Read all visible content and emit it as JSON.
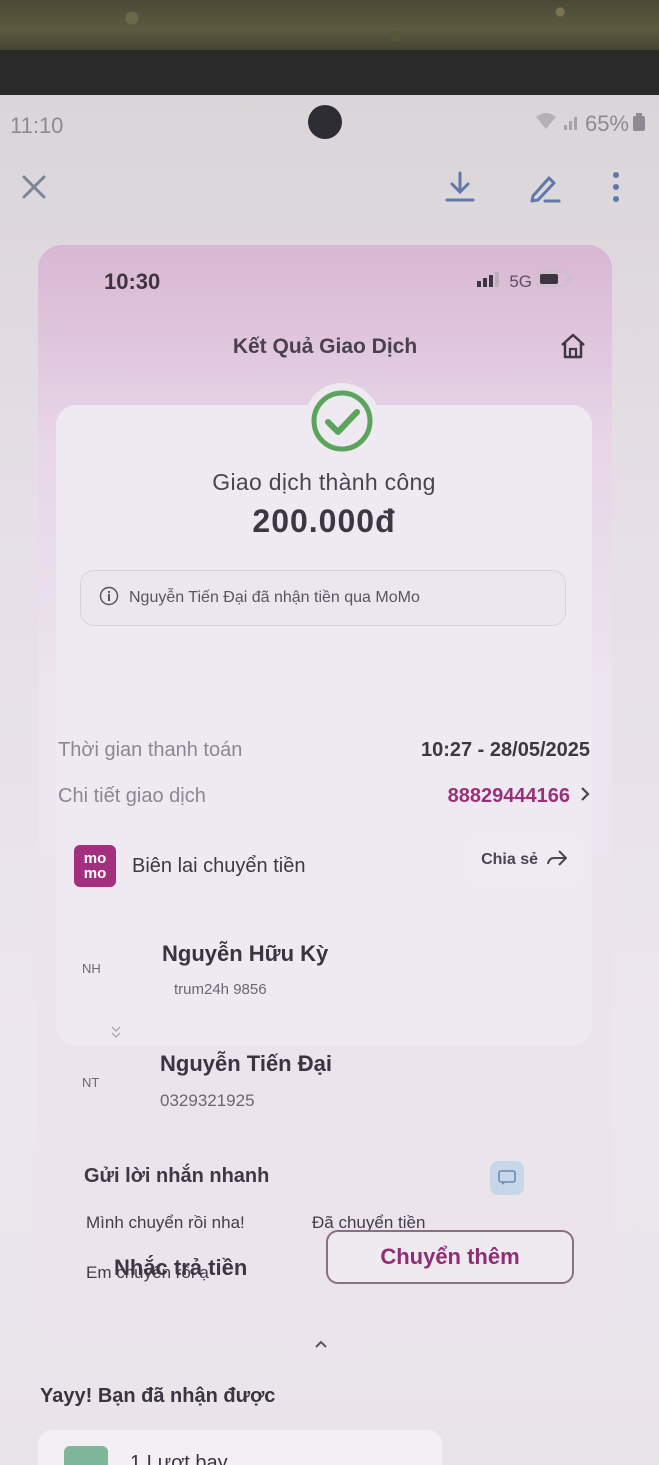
{
  "system": {
    "time": "11:10",
    "battery": "65%"
  },
  "app_status": {
    "time": "10:30",
    "network": "5G"
  },
  "header": {
    "title": "Kết Quả Giao Dịch"
  },
  "result": {
    "status": "Giao dịch thành công",
    "amount": "200.000đ",
    "notice": "Nguyễn Tiến Đại đã nhận tiền qua MoMo"
  },
  "details": {
    "time_label": "Thời gian thanh toán",
    "time_value": "10:27 - 28/05/2025",
    "txn_label": "Chi tiết giao dịch",
    "txn_value": "88829444166"
  },
  "receipt": {
    "logo_top": "mo",
    "logo_bottom": "mo",
    "title": "Biên lai chuyển tiền",
    "share_label": "Chia sẻ"
  },
  "sender": {
    "initials": "NH",
    "name": "Nguyễn Hữu Kỳ",
    "sub": "trum24h 9856"
  },
  "receiver": {
    "initials": "NT",
    "name": "Nguyễn Tiến Đại",
    "phone": "0329321925"
  },
  "quick_message": {
    "title": "Gửi lời nhắn nhanh",
    "chips": [
      "Mình chuyển rồi nha!",
      "Đã chuyển tiền",
      "Em chuyển rồi ạ"
    ]
  },
  "actions": {
    "remind": "Nhắc trả tiền",
    "transfer_more": "Chuyển thêm"
  },
  "rewards": {
    "heading": "Yayy! Bạn đã nhận được",
    "item": "1 Lượt bay"
  },
  "colors": {
    "brand": "#a2307f",
    "success": "#4caf50"
  }
}
